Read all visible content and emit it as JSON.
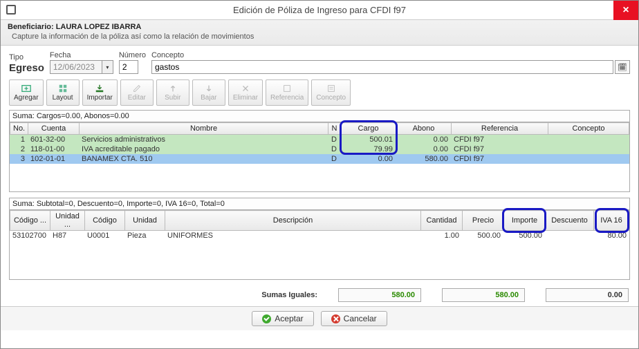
{
  "title": "Edición de Póliza de Ingreso para CFDI f97",
  "beneficiario_label": "Beneficiario:",
  "beneficiario_value": "LAURA LOPEZ IBARRA",
  "instruction": "Capture la información de la póliza así como la relación de movimientos",
  "form": {
    "tipo_label": "Tipo",
    "tipo_value": "Egreso",
    "fecha_label": "Fecha",
    "fecha_value": "12/06/2023",
    "numero_label": "Número",
    "numero_value": "2",
    "concepto_label": "Concepto",
    "concepto_value": "gastos"
  },
  "toolbar": {
    "agregar": "Agregar",
    "layout": "Layout",
    "importar": "Importar",
    "editar": "Editar",
    "subir": "Subir",
    "bajar": "Bajar",
    "eliminar": "Eliminar",
    "referencia": "Referencia",
    "concepto": "Concepto"
  },
  "mov_sum": "Suma:  Cargos=0.00, Abonos=0.00",
  "mov_headers": {
    "no": "No.",
    "cuenta": "Cuenta",
    "nombre": "Nombre",
    "n": "N",
    "cargo": "Cargo",
    "abono": "Abono",
    "referencia": "Referencia",
    "concepto": "Concepto"
  },
  "mov_rows": [
    {
      "no": "1",
      "cuenta": "601-32-00",
      "nombre": "Servicios administrativos",
      "n": "D",
      "cargo": "500.01",
      "abono": "0.00",
      "ref": "CFDI f97",
      "con": ""
    },
    {
      "no": "2",
      "cuenta": "118-01-00",
      "nombre": "IVA acreditable pagado",
      "n": "D",
      "cargo": "79.99",
      "abono": "0.00",
      "ref": "CFDI f97",
      "con": ""
    },
    {
      "no": "3",
      "cuenta": "102-01-01",
      "nombre": "BANAMEX CTA. 510",
      "n": "D",
      "cargo": "0.00",
      "abono": "580.00",
      "ref": "CFDI f97",
      "con": ""
    }
  ],
  "det_sum": "Suma:  Subtotal=0, Descuento=0, Importe=0, IVA 16=0, Total=0",
  "det_headers": {
    "codigo": "Código ...",
    "unidad_c": "Unidad ...",
    "codigo2": "Código",
    "unidad": "Unidad",
    "descripcion": "Descripción",
    "cantidad": "Cantidad",
    "precio": "Precio",
    "importe": "Importe",
    "descuento": "Descuento",
    "iva16": "IVA 16"
  },
  "det_rows": [
    {
      "codigo": "53102700",
      "unidad_c": "H87",
      "codigo2": "U0001",
      "unidad": "Pieza",
      "desc": "UNIFORMES",
      "cant": "1.00",
      "precio": "500.00",
      "importe": "500.00",
      "dto": "",
      "iva": "80.00"
    }
  ],
  "sumas_label": "Sumas Iguales:",
  "sumas_iguales": {
    "a": "580.00",
    "b": "580.00",
    "c": "0.00"
  },
  "footer": {
    "aceptar": "Aceptar",
    "cancelar": "Cancelar"
  }
}
